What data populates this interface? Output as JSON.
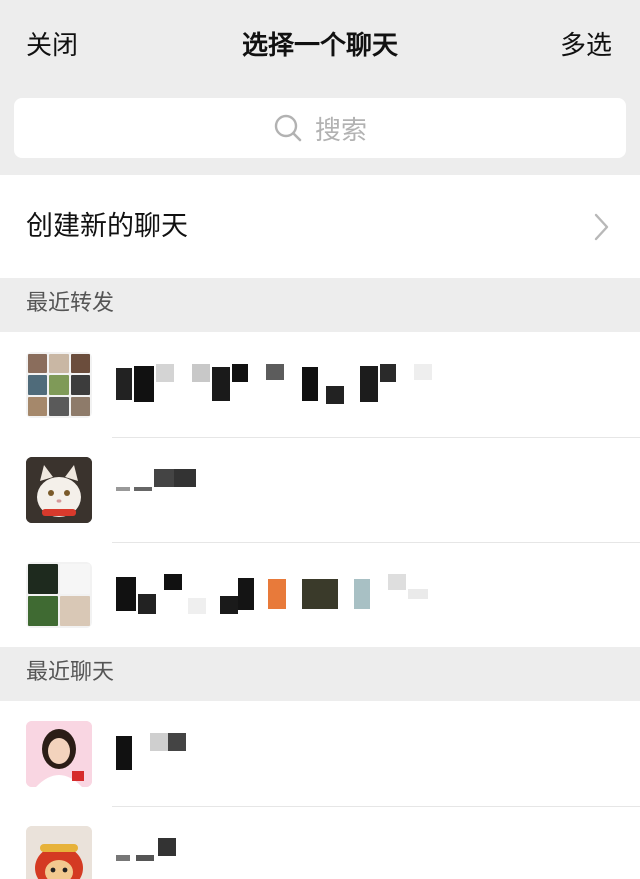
{
  "header": {
    "close_label": "关闭",
    "title": "选择一个聊天",
    "multi_select_label": "多选"
  },
  "search": {
    "placeholder": "搜索"
  },
  "create_chat": {
    "label": "创建新的聊天"
  },
  "sections": {
    "recent_forward": {
      "title": "最近转发"
    },
    "recent_chats": {
      "title": "最近聊天"
    }
  },
  "icons": {
    "search": "search-icon",
    "chevron": "chevron-right-icon"
  },
  "colors": {
    "background": "#ededed",
    "row_background": "#ffffff",
    "section_text": "#555555",
    "placeholder_text": "#b2b2b2"
  }
}
